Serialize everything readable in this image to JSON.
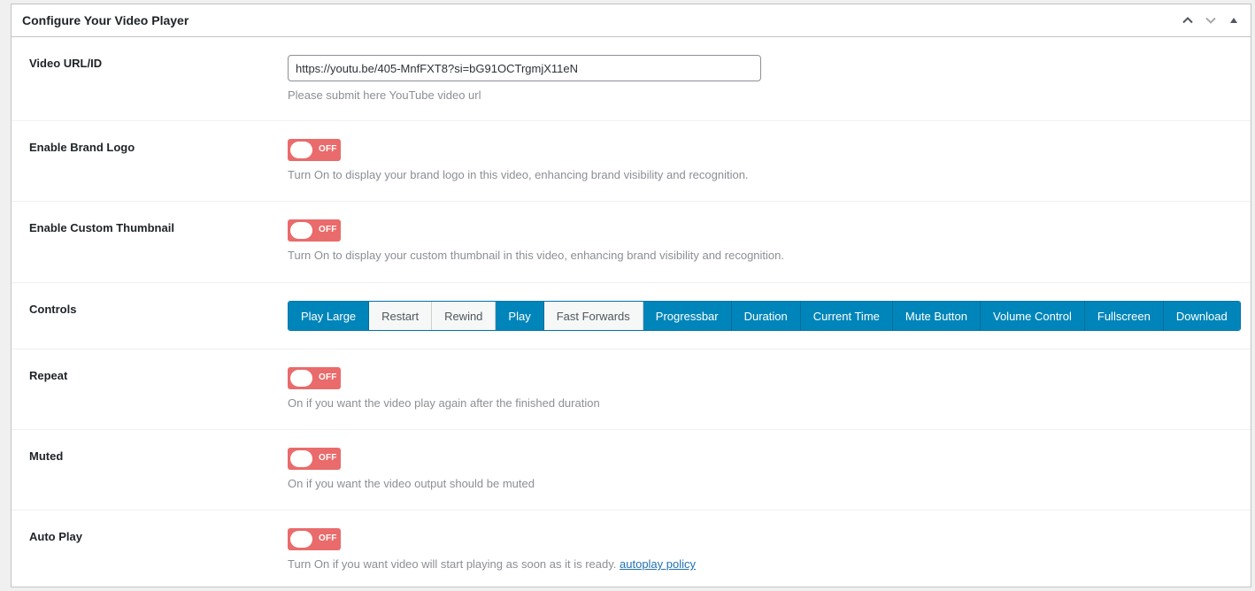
{
  "metabox": {
    "title": "Configure Your Video Player",
    "header_icons": [
      "chevron-up-icon",
      "chevron-down-icon",
      "triangle-up-icon"
    ]
  },
  "video_url": {
    "label": "Video URL/ID",
    "value": "https://youtu.be/405-MnfFXT8?si=bG91OCTrgmjX11eN",
    "description": "Please submit here YouTube video url"
  },
  "brand_logo": {
    "label": "Enable Brand Logo",
    "state": "OFF",
    "description": "Turn On to display your brand logo in this video, enhancing brand visibility and recognition."
  },
  "custom_thumbnail": {
    "label": "Enable Custom Thumbnail",
    "state": "OFF",
    "description": "Turn On to display your custom thumbnail in this video, enhancing brand visibility and recognition."
  },
  "controls": {
    "label": "Controls",
    "items": [
      {
        "label": "Play Large",
        "active": true
      },
      {
        "label": "Restart",
        "active": false
      },
      {
        "label": "Rewind",
        "active": false
      },
      {
        "label": "Play",
        "active": true
      },
      {
        "label": "Fast Forwards",
        "active": false
      },
      {
        "label": "Progressbar",
        "active": true
      },
      {
        "label": "Duration",
        "active": true
      },
      {
        "label": "Current Time",
        "active": true
      },
      {
        "label": "Mute Button",
        "active": true
      },
      {
        "label": "Volume Control",
        "active": true
      },
      {
        "label": "Fullscreen",
        "active": true
      },
      {
        "label": "Download",
        "active": true
      }
    ]
  },
  "repeat": {
    "label": "Repeat",
    "state": "OFF",
    "description": "On if you want the video play again after the finished duration"
  },
  "muted": {
    "label": "Muted",
    "state": "OFF",
    "description": "On if you want the video output should be muted"
  },
  "autoplay": {
    "label": "Auto Play",
    "state": "OFF",
    "description": "Turn On if you want video will start playing as soon as it is ready.",
    "link_text": "autoplay policy"
  },
  "colors": {
    "toggle_off": "#e96b6b",
    "active_button": "#0085ba",
    "inactive_button": "#f6f7f7"
  }
}
